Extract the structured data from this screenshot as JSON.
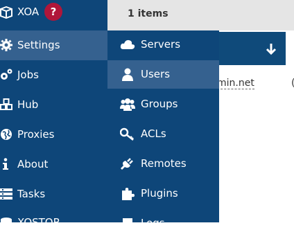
{
  "main": {
    "items_count": "1 items",
    "row_text": "min.net",
    "row_text2": "("
  },
  "sidebar": {
    "items": [
      {
        "label": "XOA",
        "icon": "cube-icon",
        "badge": "?"
      },
      {
        "label": "Settings",
        "icon": "gear-icon",
        "active": true
      },
      {
        "label": "Jobs",
        "icon": "gears-icon"
      },
      {
        "label": "Hub",
        "icon": "cubes-icon"
      },
      {
        "label": "Proxies",
        "icon": "globe-icon"
      },
      {
        "label": "About",
        "icon": "info-icon"
      },
      {
        "label": "Tasks",
        "icon": "tasks-icon"
      },
      {
        "label": "XOSTOR",
        "icon": "database-icon"
      }
    ]
  },
  "submenu": {
    "items": [
      {
        "label": "Servers",
        "icon": "cloud-icon"
      },
      {
        "label": "Users",
        "icon": "user-icon",
        "hover": true
      },
      {
        "label": "Groups",
        "icon": "users-icon"
      },
      {
        "label": "ACLs",
        "icon": "key-icon"
      },
      {
        "label": "Remotes",
        "icon": "plug-icon"
      },
      {
        "label": "Plugins",
        "icon": "puzzle-icon"
      },
      {
        "label": "Logs",
        "icon": "book-icon"
      }
    ]
  },
  "colors": {
    "sidebar_bg": "#0e4679",
    "active_bg": "#35618f",
    "badge_bg": "#b0163a"
  }
}
